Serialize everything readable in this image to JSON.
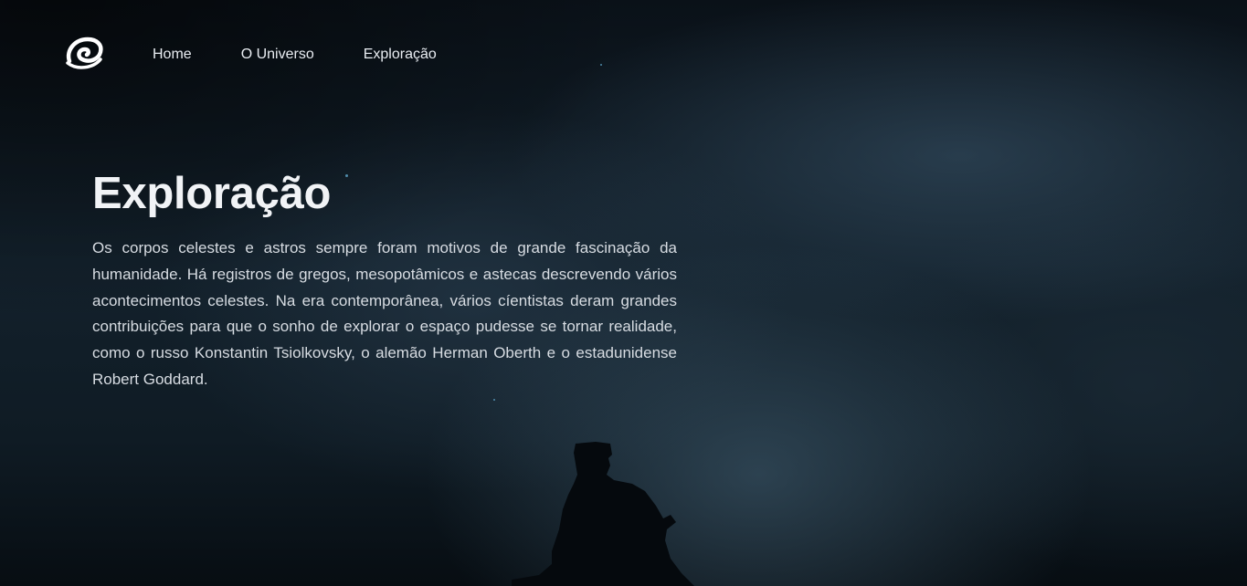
{
  "logo": {
    "icon": "swirl-logo-icon"
  },
  "nav": {
    "items": [
      {
        "label": "Home"
      },
      {
        "label": "O Universo"
      },
      {
        "label": "Exploração"
      }
    ]
  },
  "main": {
    "title": "Exploração",
    "paragraph": "Os corpos celestes e astros sempre foram motivos de grande fascinação da humanidade. Há registros de gregos, mesopotâmicos e astecas descrevendo vários acontecimentos celestes. Na era contemporânea, vários cíentistas deram grandes contribuições para que o sonho de explorar o espaço pudesse se tornar realidade, como o russo Konstantin Tsiolkovsky, o alemão Herman Oberth e o estadunidense Robert Goddard."
  },
  "colors": {
    "background": "#0f1b24",
    "text": "#e6e9ee"
  }
}
